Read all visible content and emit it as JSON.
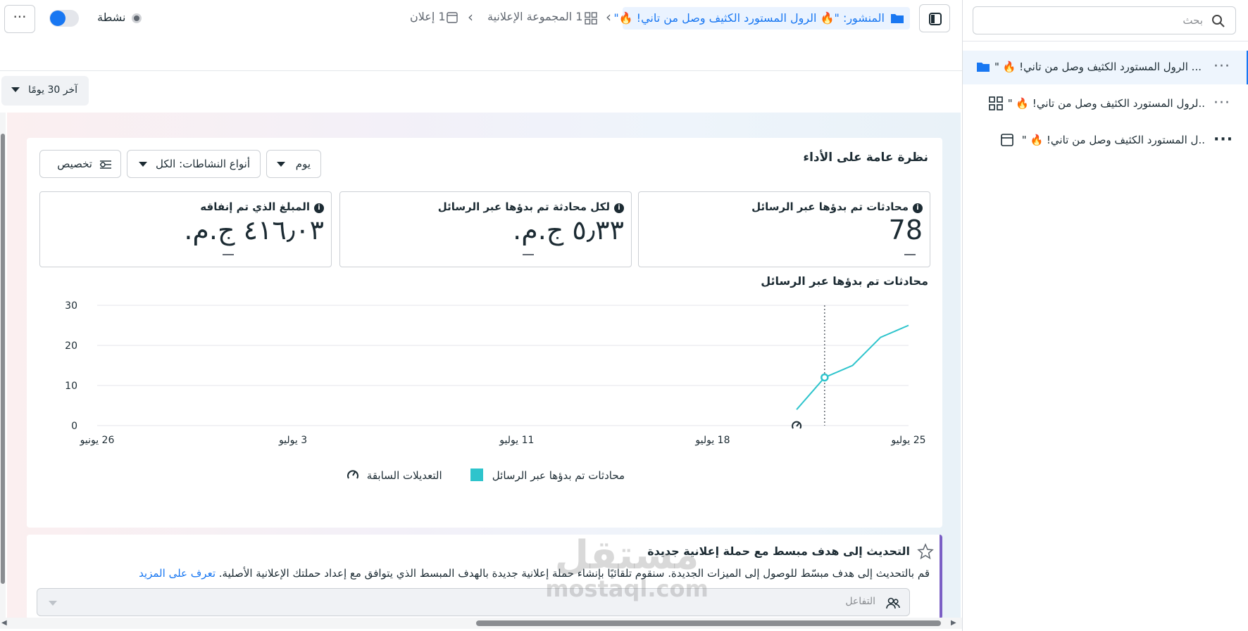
{
  "sidebar": {
    "search_placeholder": "بحث",
    "items": [
      {
        "label": "... الرول المستورد الكثيف وصل من تاني! 🔥 \"",
        "type": "campaign"
      },
      {
        "label": "..لرول المستورد الكثيف وصل من تاني! 🔥 \"",
        "type": "adset"
      },
      {
        "label": "..ل المستورد الكثيف وصل من تاني! 🔥 \"",
        "type": "ad"
      }
    ]
  },
  "topbar": {
    "more_label": "···",
    "status_label": "نشطة",
    "crumb_post": "المنشور: \"🔥 الرول المستورد الكثيف وصل من تاني! 🔥\"",
    "crumb_adset": "1 المجموعة الإعلانية",
    "crumb_ad": "1 إعلان"
  },
  "date_range": "آخر 30 يومًا",
  "overview": {
    "title": "نظرة عامة على الأداء",
    "granularity": "يوم",
    "activity_types": "أنواع النشاطات: الكل",
    "customize": "تخصيص",
    "metrics": [
      {
        "label": "محادثات تم بدؤها عبر الرسائل",
        "value": "78"
      },
      {
        "label": "لكل محادثة تم بدؤها عبر الرسائل",
        "value": "٥٫٣٣ ج.م."
      },
      {
        "label": "المبلغ الذي تم إنفاقه",
        "value": "٤١٦٫٠٣ ج.م."
      }
    ],
    "chart_title": "محادثات تم بدؤها عبر الرسائل",
    "legend_series": "محادثات تم بدؤها عبر الرسائل",
    "legend_edits": "التعديلات السابقة"
  },
  "chart_data": {
    "type": "line",
    "x_ticks": [
      "26 يونيو",
      "3 يوليو",
      "11 يوليو",
      "18 يوليو",
      "25 يوليو"
    ],
    "x_tick_days": [
      0,
      7,
      15,
      22,
      29
    ],
    "ylim": [
      0,
      30
    ],
    "y_ticks": [
      0,
      10,
      20,
      30
    ],
    "series": [
      {
        "name": "محادثات تم بدؤها عبر الرسائل",
        "color": "#2ec4cc",
        "points": [
          [
            25,
            4
          ],
          [
            26,
            12
          ],
          [
            27,
            15
          ],
          [
            28,
            22
          ],
          [
            29,
            25
          ]
        ]
      }
    ],
    "highlight_day": 26,
    "edit_marker_day": 25,
    "grid": true
  },
  "notice": {
    "title": "التحديث إلى هدف مبسط مع حملة إعلانية جديدة",
    "body": "قم بالتحديث إلى هدف مبسّط للوصول إلى الميزات الجديدة. سنقوم تلقائيًا بإنشاء حملة إعلانية جديدة بالهدف المبسط الذي يتوافق مع إعداد حملتك الإعلانية الأصلية.",
    "link": "تعرف على المزيد",
    "input_placeholder": "التفاعل"
  },
  "watermark": {
    "line1": "مستقل",
    "line2": "mostaql.com"
  },
  "colors": {
    "accent": "#1877f2",
    "series": "#2ec4cc",
    "notice_bar": "#7b5fc5"
  }
}
